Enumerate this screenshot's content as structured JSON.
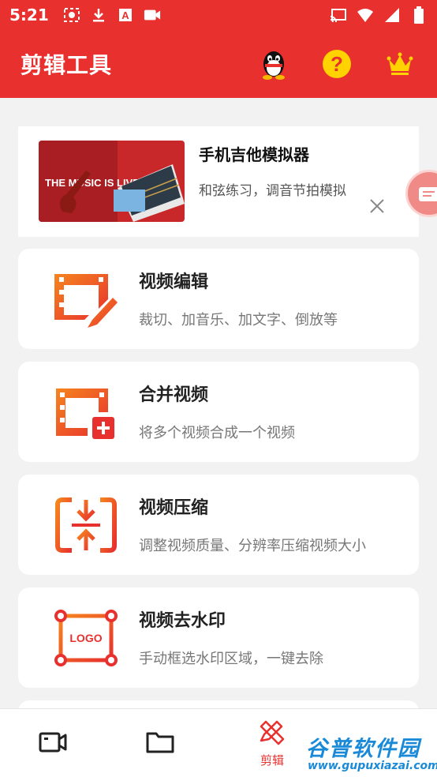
{
  "status_bar": {
    "time": "5:21",
    "left_icons": [
      "screen-record-icon",
      "download-icon",
      "text-a-icon",
      "video-camera-icon"
    ],
    "right_icons": [
      "cast-icon",
      "wifi-icon",
      "signal-icon",
      "battery-icon"
    ]
  },
  "app_bar": {
    "title": "剪辑工具",
    "actions": [
      "qq-icon",
      "help-icon",
      "crown-icon"
    ]
  },
  "ad": {
    "title": "手机吉他模拟器",
    "subtitle": "和弦练习，调音节拍模拟",
    "image_text": "THE MUSIC IS LIVE"
  },
  "tools": [
    {
      "title": "视频编辑",
      "subtitle": "裁切、加音乐、加文字、倒放等",
      "icon": "video-edit-icon"
    },
    {
      "title": "合并视频",
      "subtitle": "将多个视频合成一个视频",
      "icon": "video-merge-icon"
    },
    {
      "title": "视频压缩",
      "subtitle": "调整视频质量、分辨率压缩视频大小",
      "icon": "video-compress-icon"
    },
    {
      "title": "视频去水印",
      "subtitle": "手动框选水印区域，一键去除",
      "icon": "logo-remove-icon",
      "icon_text": "LOGO"
    }
  ],
  "tab_bar": {
    "tabs": [
      {
        "icon": "video-tab-icon",
        "label": ""
      },
      {
        "icon": "folder-tab-icon",
        "label": ""
      },
      {
        "icon": "edit-tools-tab-icon",
        "label": "剪辑"
      }
    ],
    "active_color": "#e8302e"
  },
  "watermark": {
    "name": "谷普软件园",
    "url": "www.gupuxiazai.com"
  },
  "colors": {
    "primary": "#e8302e",
    "icon_orange": "#f26b1d",
    "icon_red": "#e8302e",
    "help_yellow": "#ffd200"
  }
}
